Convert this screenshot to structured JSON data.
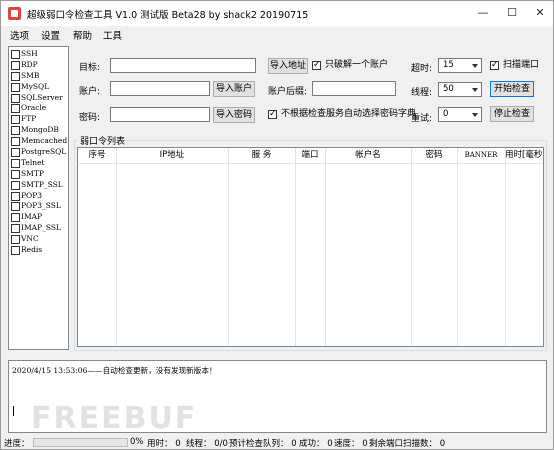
{
  "window": {
    "title": "超级弱口令检查工具 V1.0 测试版 Beta28 by shack2 20190715",
    "minimize": "—",
    "maximize": "☐",
    "close": "✕"
  },
  "menu": [
    "选项",
    "设置",
    "帮助",
    "工具"
  ],
  "protocols": [
    "SSH",
    "RDP",
    "SMB",
    "MySQL",
    "SQLServer",
    "Oracle",
    "FTP",
    "MongoDB",
    "Memcached",
    "PostgreSQL",
    "Telnet",
    "SMTP",
    "SMTP_SSL",
    "POP3",
    "POP3_SSL",
    "IMAP",
    "IMAP_SSL",
    "VNC",
    "Redis"
  ],
  "form": {
    "target_label": "目标:",
    "account_label": "账户:",
    "password_label": "密码:",
    "import_address": "导入地址",
    "import_account": "导入账户",
    "import_password": "导入密码",
    "only_crack_one": "只破解一个账户",
    "account_suffix_label": "账户后缀:",
    "no_auto_dict": "不根据检查服务自动选择密码字典",
    "timeout_label": "超时:",
    "timeout_value": "15",
    "threads_label": "线程:",
    "threads_value": "50",
    "retry_label": "重试:",
    "retry_value": "0",
    "scan_port": "扫描端口",
    "start_check": "开始检查",
    "stop_check": "停止检查"
  },
  "results": {
    "group_title": "弱口令列表",
    "columns": [
      "序号",
      "IP地址",
      "服 务",
      "端口",
      "帐户名",
      "密码",
      "BANNER",
      "用时[毫秒]"
    ]
  },
  "log": {
    "line": "2020/4/15 13:53:06——自动检查更新，没有发现新版本！",
    "watermark": "FREEBUF"
  },
  "status": {
    "progress_label": "进度：",
    "progress_value": 0,
    "progress_text": "0%",
    "elapsed": "用时： 0",
    "threads": "线程： 0/0",
    "queue": "预计检查队列： 0",
    "success": "成功： 0",
    "speed": "速度： 0",
    "remaining": "剩余端口扫描数： 0"
  }
}
